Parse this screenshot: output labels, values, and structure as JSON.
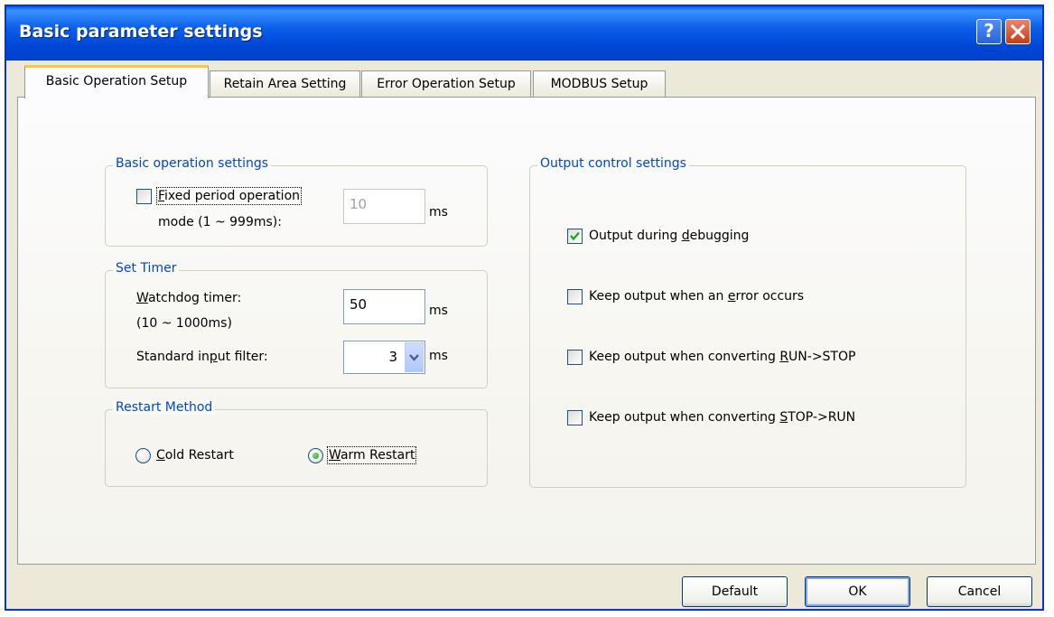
{
  "window": {
    "title": "Basic parameter settings",
    "help_label": "?",
    "accent_color": "#0046d5"
  },
  "tabs": [
    {
      "label": "Basic Operation Setup",
      "active": true
    },
    {
      "label": "Retain Area Setting",
      "active": false
    },
    {
      "label": "Error Operation Setup",
      "active": false
    },
    {
      "label": "MODBUS Setup",
      "active": false
    }
  ],
  "basic_operation": {
    "legend": "Basic operation settings",
    "fixed_period_label": "Fixed period operation",
    "fixed_period_range": "mode (1 ~ 999ms):",
    "fixed_period_checked": false,
    "fixed_period_value": "10",
    "unit": "ms"
  },
  "set_timer": {
    "legend": "Set Timer",
    "watchdog_label": "Watchdog timer:",
    "watchdog_range": "(10 ~ 1000ms)",
    "watchdog_value": "50",
    "watchdog_unit": "ms",
    "filter_label": "Standard input filter:",
    "filter_value": "3",
    "filter_unit": "ms"
  },
  "restart": {
    "legend": "Restart Method",
    "cold_label": "Cold Restart",
    "warm_label": "Warm Restart",
    "selected": "warm"
  },
  "output_control": {
    "legend": "Output control settings",
    "items": [
      {
        "label": "Output during debugging",
        "checked": true
      },
      {
        "label": "Keep output when an error occurs",
        "checked": false
      },
      {
        "label": "Keep output when converting RUN->STOP",
        "checked": false
      },
      {
        "label": "Keep output when converting STOP->RUN",
        "checked": false
      }
    ]
  },
  "buttons": {
    "default_label": "Default",
    "ok_label": "OK",
    "cancel_label": "Cancel"
  }
}
